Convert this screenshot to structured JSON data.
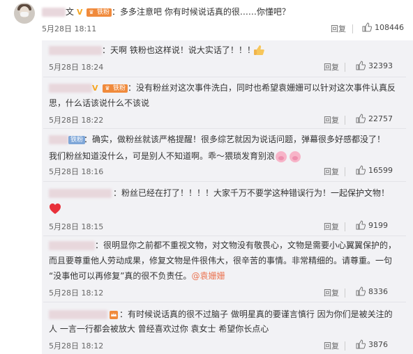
{
  "main_comment": {
    "user_suffix": "文",
    "badge": "铁粉",
    "text": "：多多注意吧 你有时候说话真的很……你懂吧？",
    "time": "5月28日 18:11",
    "reply_label": "回复",
    "likes": "108446"
  },
  "replies": [
    {
      "text": "：天啊 铁粉也这样说！说大实话了！！！",
      "emoji": "thumbs-up-icon",
      "time": "5月28日 18:24",
      "reply_label": "回复",
      "likes": "32393"
    },
    {
      "badge": "铁粉",
      "line1": "：没有粉丝对这次事件洗白，同时也希望袁姗姗可以针对这次事件认真反",
      "line2": "思，什么话该说什么不该说",
      "time": "5月28日 18:22",
      "reply_label": "回复",
      "likes": "22757"
    },
    {
      "badge": "铁粉",
      "line1": "：确实，做粉丝就该严格提醒！很多综艺就因为说话问题，弹幕很多好感都没了！",
      "line2": "我们粉丝知道没什么，可是别人不知道啊。乖～猥琐发育别浪",
      "emoji": "pig-face-icon",
      "time": "5月28日 18:16",
      "reply_label": "回复",
      "likes": "16599"
    },
    {
      "line1": "：粉丝已经在打了！！！！大家千万不要学这种错误行为！一起保护文物！",
      "emoji": "red-heart-icon",
      "time": "5月28日 18:15",
      "reply_label": "回复",
      "likes": "9199"
    },
    {
      "line1": "：很明显你之前都不重视文物，对文物没有敬畏心，文物是需要小心翼翼保护的，",
      "line2": "而且要尊重他人劳动成果，修复文物是件很伟大，很辛苦的事情。非常精细的。请尊重。一句",
      "line3": "“没事他可以再修复”真的很不负责任。",
      "mention": "@袁姗姗",
      "time": "5月28日 18:12",
      "reply_label": "回复",
      "likes": "8336"
    },
    {
      "line1": "：有时候说话真的很不过脑子 做明星真的要谨言慎行 因为你们是被关注的",
      "line2": "人 一言一行都会被放大 曾经喜欢过你 袁女士 希望你长点心",
      "time": "5月28日 18:12",
      "reply_label": "回复",
      "likes": "3876"
    }
  ],
  "colors": {
    "accent": "#eb7350",
    "badge": "#f08a3c",
    "list_bg": "#f2f2f5"
  }
}
